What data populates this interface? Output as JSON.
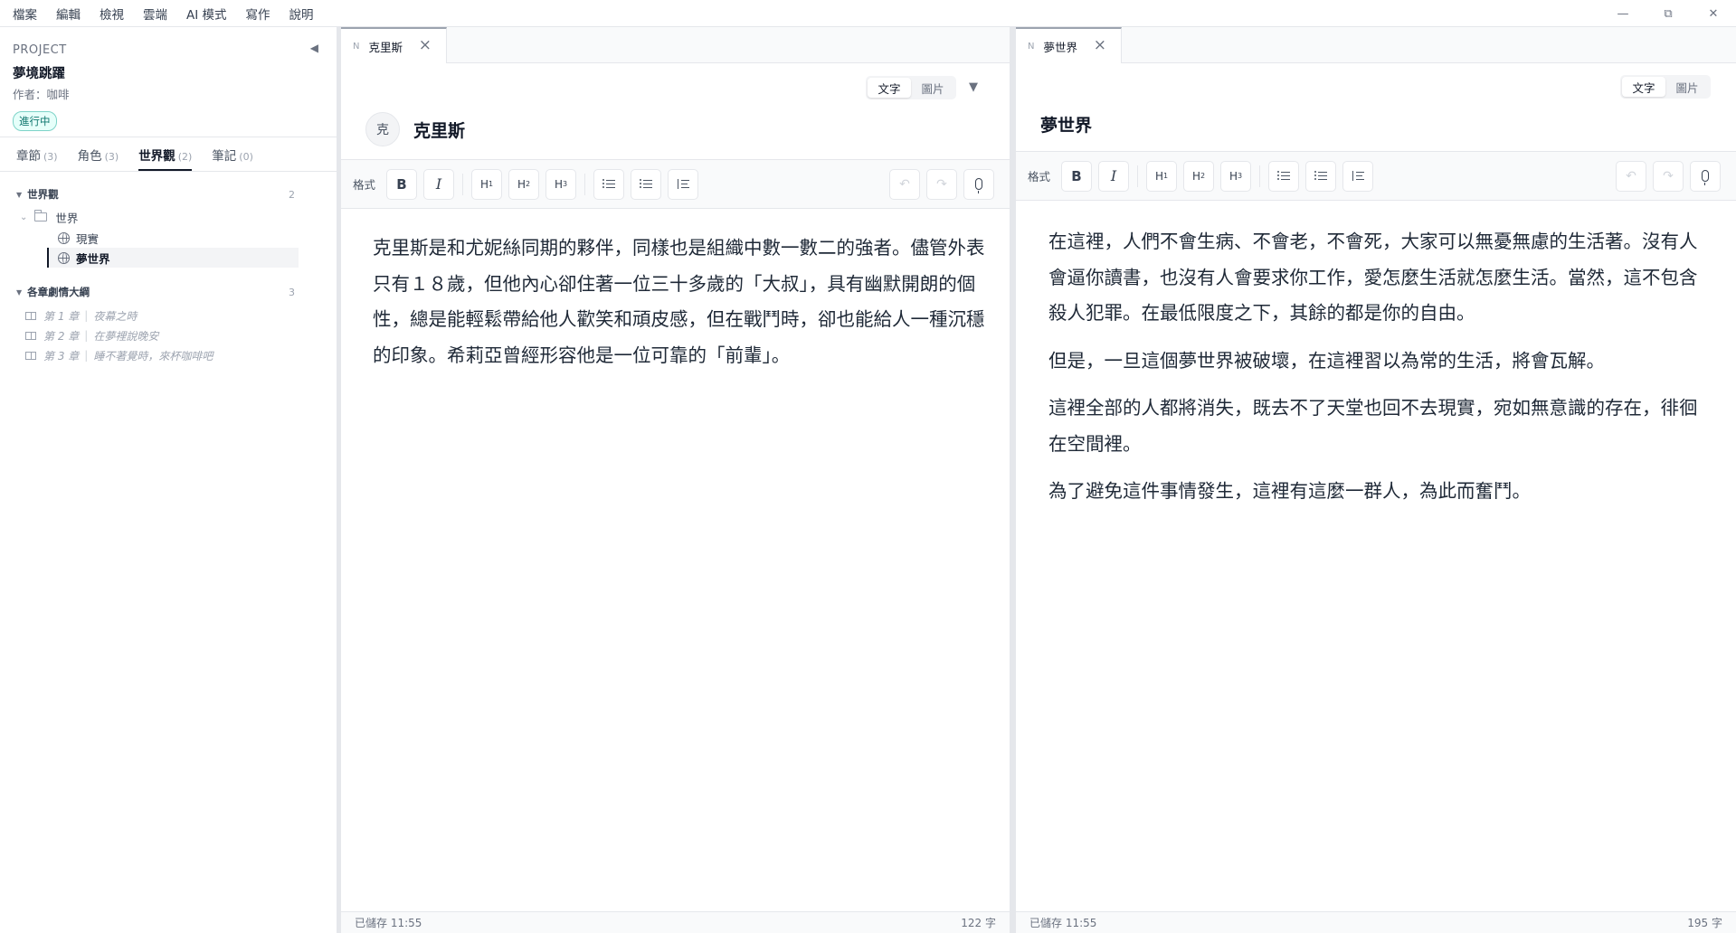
{
  "menubar": {
    "items": [
      "檔案",
      "編輯",
      "檢視",
      "雲端",
      "AI 模式",
      "寫作",
      "說明"
    ],
    "window_controls": {
      "minimize": "—",
      "restore": "⧉",
      "close": "✕"
    }
  },
  "sidebar": {
    "project_label": "PROJECT",
    "project_title": "夢境跳躍",
    "author": "作者：咖啡",
    "status": "進行中",
    "collapse_glyph": "◀",
    "tabs": [
      {
        "label": "章節",
        "count": "(3)"
      },
      {
        "label": "角色",
        "count": "(3)"
      },
      {
        "label": "世界觀",
        "count": "(2)"
      },
      {
        "label": "筆記",
        "count": "(0)"
      }
    ],
    "active_tab": "世界觀",
    "worldview_section": {
      "title": "世界觀",
      "count": "2"
    },
    "folder": {
      "label": "世界"
    },
    "world_items": [
      {
        "label": "現實"
      },
      {
        "label": "夢世界"
      }
    ],
    "outline_section": {
      "title": "各章劇情大綱",
      "count": "3"
    },
    "chapters": [
      {
        "number": "第 1 章",
        "title": "夜幕之時"
      },
      {
        "number": "第 2 章",
        "title": "在夢裡說晚安"
      },
      {
        "number": "第 3 章",
        "title": "睡不著覺時，來杯咖啡吧"
      }
    ]
  },
  "editor_left": {
    "tab_marker": "N",
    "tab_label": "克里斯",
    "mode": {
      "text": "文字",
      "image": "圖片",
      "active": "text"
    },
    "avatar_char": "克",
    "title": "克里斯",
    "toolbar": {
      "format_label": "格式",
      "bold": "B",
      "italic": "I",
      "h1": "H",
      "h1_sub": "1",
      "h2": "H",
      "h2_sub": "2",
      "h3": "H",
      "h3_sub": "3",
      "undo": "↶",
      "redo": "↷"
    },
    "paragraphs": [
      "克里斯是和尤妮絲同期的夥伴，同樣也是組織中數一數二的強者。儘管外表只有１８歲，但他內心卻住著一位三十多歲的「大叔」，具有幽默開朗的個性，總是能輕鬆帶給他人歡笑和頑皮感，但在戰鬥時，卻也能給人一種沉穩的印象。希莉亞曾經形容他是一位可靠的「前輩」。"
    ],
    "footer_saved": "已儲存 11:55",
    "footer_count": "122 字"
  },
  "editor_right": {
    "tab_marker": "N",
    "tab_label": "夢世界",
    "mode": {
      "text": "文字",
      "image": "圖片",
      "active": "text"
    },
    "title": "夢世界",
    "toolbar": {
      "format_label": "格式",
      "bold": "B",
      "italic": "I",
      "h1": "H",
      "h1_sub": "1",
      "h2": "H",
      "h2_sub": "2",
      "h3": "H",
      "h3_sub": "3",
      "undo": "↶",
      "redo": "↷"
    },
    "paragraphs": [
      "在這裡，人們不會生病、不會老，不會死，大家可以無憂無慮的生活著。沒有人會逼你讀書，也沒有人會要求你工作，愛怎麼生活就怎麼生活。當然，這不包含殺人犯罪。在最低限度之下，其餘的都是你的自由。",
      "但是，一旦這個夢世界被破壞，在這裡習以為常的生活，將會瓦解。",
      "這裡全部的人都將消失，既去不了天堂也回不去現實，宛如無意識的存在，徘徊在空間裡。",
      "為了避免這件事情發生，這裡有這麼一群人，為此而奮鬥。"
    ],
    "footer_saved": "已儲存 11:55",
    "footer_count": "195 字"
  }
}
